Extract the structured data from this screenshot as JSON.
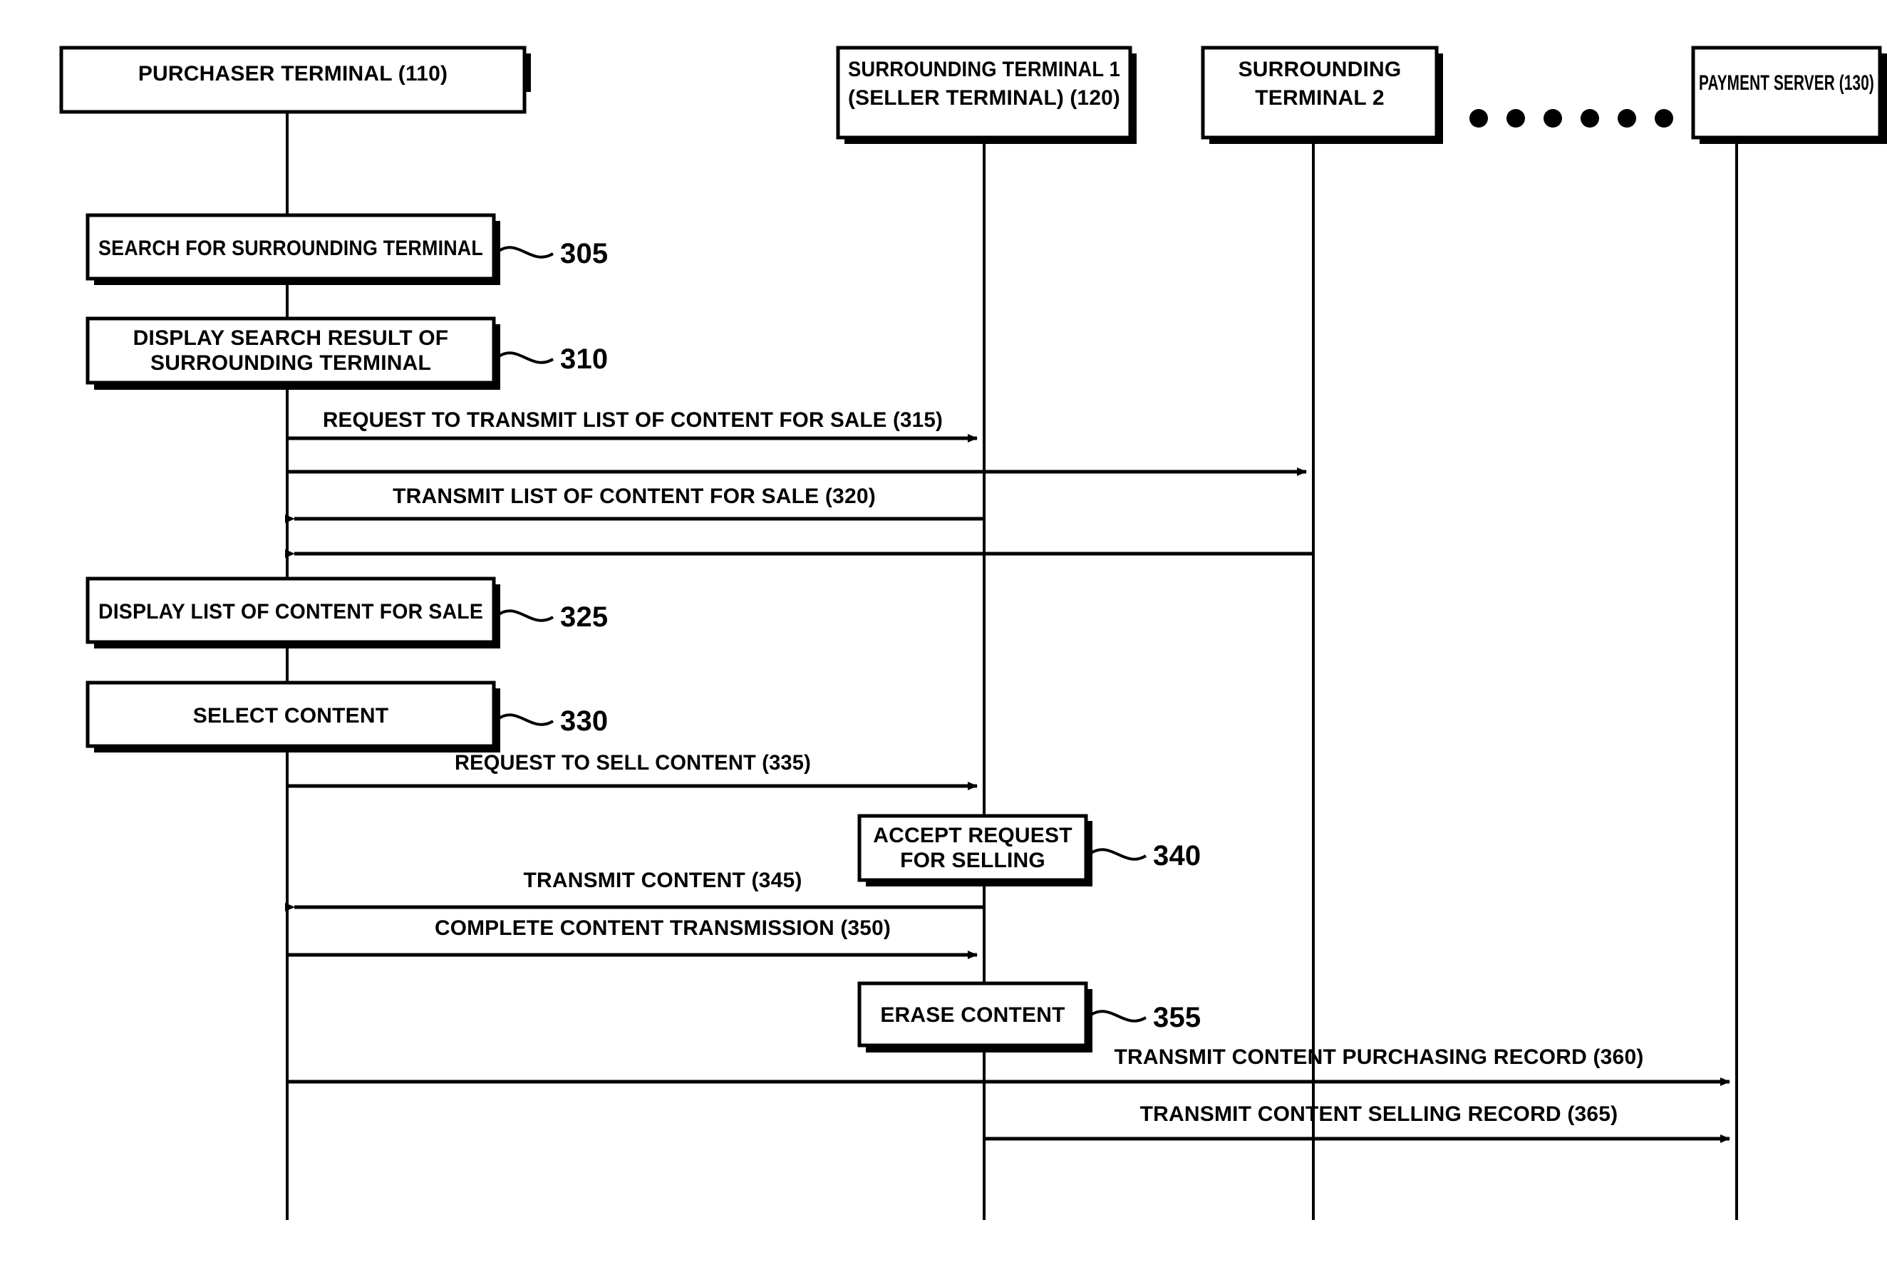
{
  "diagram": {
    "title": "Content trading sequence between purchaser terminal, surrounding terminals and payment server",
    "type": "sequence-diagram"
  },
  "actors": [
    {
      "id": "purchaser",
      "line1": "PURCHASER TERMINAL (110)",
      "line2": ""
    },
    {
      "id": "seller",
      "line1": "SURROUNDING TERMINAL 1",
      "line2": "(SELLER TERMINAL) (120)"
    },
    {
      "id": "terminal2",
      "line1": "SURROUNDING",
      "line2": "TERMINAL 2"
    },
    {
      "id": "server",
      "line1": "PAYMENT SERVER (130)",
      "line2": ""
    }
  ],
  "ellipsis": {
    "name": "ellipsis-dots",
    "count": 6
  },
  "processes": [
    {
      "id": "p305",
      "label_line1": "SEARCH FOR SURROUNDING TERMINAL",
      "label_line2": "",
      "ref": "305"
    },
    {
      "id": "p310",
      "label_line1": "DISPLAY SEARCH RESULT OF",
      "label_line2": "SURROUNDING TERMINAL",
      "ref": "310"
    },
    {
      "id": "p325",
      "label_line1": "DISPLAY LIST OF CONTENT FOR SALE",
      "label_line2": "",
      "ref": "325"
    },
    {
      "id": "p330",
      "label_line1": "SELECT CONTENT",
      "label_line2": "",
      "ref": "330"
    },
    {
      "id": "p340",
      "label_line1": "ACCEPT REQUEST",
      "label_line2": "FOR SELLING",
      "ref": "340"
    },
    {
      "id": "p355",
      "label_line1": "ERASE CONTENT",
      "label_line2": "",
      "ref": "355"
    }
  ],
  "messages": [
    {
      "id": "m315",
      "label": "REQUEST TO TRANSMIT LIST OF CONTENT FOR SALE (315)",
      "ref": "315",
      "from": "purchaser",
      "to": "seller",
      "direction": "right"
    },
    {
      "id": "m315b",
      "label": "",
      "ref": "315",
      "from": "purchaser",
      "to": "terminal2",
      "direction": "right"
    },
    {
      "id": "m320",
      "label": "TRANSMIT LIST OF CONTENT FOR SALE (320)",
      "ref": "320",
      "from": "seller",
      "to": "purchaser",
      "direction": "left"
    },
    {
      "id": "m320b",
      "label": "",
      "ref": "320",
      "from": "terminal2",
      "to": "purchaser",
      "direction": "left"
    },
    {
      "id": "m335",
      "label": "REQUEST TO SELL CONTENT (335)",
      "ref": "335",
      "from": "purchaser",
      "to": "seller",
      "direction": "right"
    },
    {
      "id": "m345",
      "label": "TRANSMIT CONTENT (345)",
      "ref": "345",
      "from": "seller",
      "to": "purchaser",
      "direction": "left"
    },
    {
      "id": "m350",
      "label": "COMPLETE CONTENT TRANSMISSION (350)",
      "ref": "350",
      "from": "purchaser",
      "to": "seller",
      "direction": "right"
    },
    {
      "id": "m360",
      "label": "TRANSMIT CONTENT PURCHASING RECORD (360)",
      "ref": "360",
      "from": "purchaser",
      "to": "server",
      "direction": "right"
    },
    {
      "id": "m365",
      "label": "TRANSMIT CONTENT SELLING RECORD (365)",
      "ref": "365",
      "from": "seller",
      "to": "server",
      "direction": "right"
    }
  ],
  "colors": {
    "ink": "#000000",
    "paper": "#ffffff"
  }
}
